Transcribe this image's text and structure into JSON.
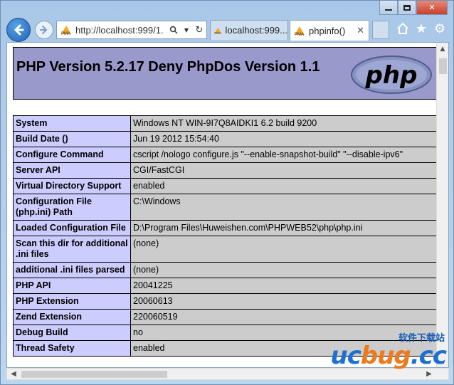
{
  "browser": {
    "address": "http://localhost:999/1.",
    "tabs": [
      {
        "label": "localhost:999..."
      },
      {
        "label": "phpinfo()"
      }
    ]
  },
  "page": {
    "title": "PHP Version 5.2.17 Deny PhpDos Version 1.1",
    "logo_text": "php",
    "rows": [
      {
        "key": "System",
        "value": "Windows NT WIN-9I7Q8AIDKI1 6.2 build 9200"
      },
      {
        "key": "Build Date ()",
        "value": "Jun 19 2012 15:54:40"
      },
      {
        "key": "Configure Command",
        "value": "cscript /nologo configure.js \"--enable-snapshot-build\" \"--disable-ipv6\""
      },
      {
        "key": "Server API",
        "value": "CGI/FastCGI"
      },
      {
        "key": "Virtual Directory Support",
        "value": "enabled"
      },
      {
        "key": "Configuration File (php.ini) Path",
        "value": "C:\\Windows"
      },
      {
        "key": "Loaded Configuration File",
        "value": "D:\\Program Files\\Huweishen.com\\PHPWEB52\\php\\php.ini"
      },
      {
        "key": "Scan this dir for additional .ini files",
        "value": "(none)"
      },
      {
        "key": "additional .ini files parsed",
        "value": "(none)"
      },
      {
        "key": "PHP API",
        "value": "20041225"
      },
      {
        "key": "PHP Extension",
        "value": "20060613"
      },
      {
        "key": "Zend Extension",
        "value": "220060519"
      },
      {
        "key": "Debug Build",
        "value": "no"
      },
      {
        "key": "Thread Safety",
        "value": "enabled"
      }
    ]
  },
  "watermark": {
    "cn": "软件下载站",
    "brand_a": "uc",
    "brand_b": "bug",
    "brand_c": ".cc"
  },
  "colors": {
    "header_bg": "#9999cc",
    "key_bg": "#ccccff",
    "value_bg": "#cccccc",
    "back_button": "#1f63b5"
  }
}
